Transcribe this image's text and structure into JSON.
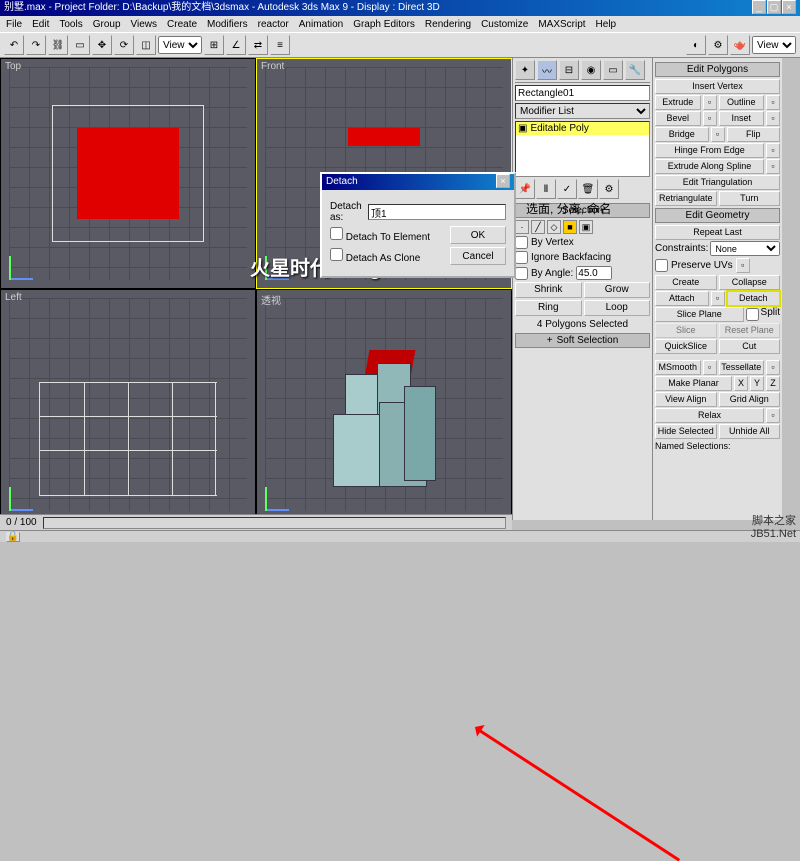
{
  "title": "别墅.max - Project Folder: D:\\Backup\\我的文档\\3dsmax - Autodesk 3ds Max 9 - Display : Direct 3D",
  "menu": [
    "File",
    "Edit",
    "Tools",
    "Group",
    "Views",
    "Create",
    "Modifiers",
    "reactor",
    "Animation",
    "Graph Editors",
    "Rendering",
    "Customize",
    "MAXScript",
    "Help"
  ],
  "toolbar": {
    "view_dropdown": "View"
  },
  "viewports": {
    "top": "Top",
    "front": "Front",
    "left": "Left",
    "persp": "透视"
  },
  "detach_dialog": {
    "title": "Detach",
    "detach_as_label": "Detach as:",
    "detach_as_value": "顶1",
    "opt_element": "Detach To Element",
    "opt_clone": "Detach As Clone",
    "ok": "OK",
    "cancel": "Cancel"
  },
  "annotation": "选面, 分离, 命名",
  "command_panel": {
    "object_name": "Rectangle01",
    "modifier_list": "Modifier List",
    "stack_item": "Editable Poly",
    "rollout_selection": "Selection",
    "by_vertex": "By Vertex",
    "ignore_backfacing": "Ignore Backfacing",
    "by_angle": "By Angle:",
    "angle_value": "45.0",
    "shrink": "Shrink",
    "grow": "Grow",
    "ring": "Ring",
    "loop": "Loop",
    "sel_status": "4 Polygons Selected",
    "rollout_soft": "Soft Selection"
  },
  "edit_polygons": {
    "header": "Edit Polygons",
    "insert_vertex": "Insert Vertex",
    "extrude": "Extrude",
    "outline": "Outline",
    "bevel": "Bevel",
    "inset": "Inset",
    "bridge": "Bridge",
    "flip": "Flip",
    "hinge": "Hinge From Edge",
    "extrude_spline": "Extrude Along Spline",
    "edit_tri": "Edit Triangulation",
    "retriangulate": "Retriangulate",
    "turn": "Turn"
  },
  "edit_geometry": {
    "header": "Edit Geometry",
    "repeat": "Repeat Last",
    "constraints_label": "Constraints:",
    "constraints_value": "None",
    "preserve_uvs": "Preserve UVs",
    "create": "Create",
    "collapse": "Collapse",
    "attach": "Attach",
    "detach": "Detach",
    "slice_plane": "Slice Plane",
    "split": "Split",
    "slice": "Slice",
    "reset_plane": "Reset Plane",
    "quickslice": "QuickSlice",
    "cut": "Cut",
    "msmooth": "MSmooth",
    "tessellate": "Tessellate",
    "make_planar": "Make Planar",
    "x": "X",
    "y": "Y",
    "z": "Z",
    "view_align": "View Align",
    "grid_align": "Grid Align",
    "relax": "Relax",
    "hide_selected": "Hide Selected",
    "unhide_all": "Unhide All",
    "named_sel": "Named Selections:"
  },
  "timeline": {
    "range": "0 / 100"
  },
  "watermarks": {
    "center": "火星时代 linzg",
    "br1": "脚本之家",
    "br2": "JB51.Net"
  }
}
